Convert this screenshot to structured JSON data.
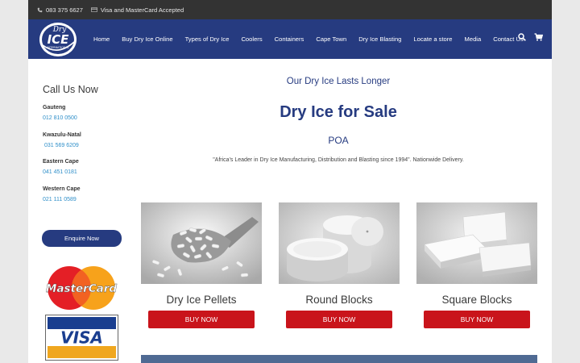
{
  "topbar": {
    "phone": "083 375 6627",
    "payments": "Visa and MasterCard Accepted",
    "phone_icon": "phone-icon",
    "card_icon": "credit-card-icon"
  },
  "logo": {
    "top": "Dry",
    "main": "ICE",
    "sub": "INTERNATIONAL"
  },
  "nav": {
    "items": [
      "Home",
      "Buy Dry Ice Online",
      "Types of Dry Ice",
      "Coolers",
      "Containers",
      "Cape Town",
      "Dry Ice Blasting",
      "Locate a store",
      "Media",
      "Contact Us"
    ],
    "search_icon": "search-icon",
    "cart_icon": "cart-icon"
  },
  "sidebar": {
    "title": "Call Us Now",
    "regions": [
      {
        "name": "Gauteng",
        "phone": "012 810 0500"
      },
      {
        "name": "Kwazulu-Natal",
        "phone": " 031 569 6209"
      },
      {
        "name": "Eastern Cape",
        "phone": "041 451 0181"
      },
      {
        "name": "Western Cape",
        "phone": "021 111 0589"
      }
    ],
    "enquire_label": "Enquire Now",
    "mastercard_text": "MasterCard",
    "visa_text": "VISA"
  },
  "main": {
    "subtitle": "Our Dry Ice Lasts Longer",
    "title": "Dry Ice for Sale",
    "price": "POA",
    "tagline": "\"Africa's Leader in Dry Ice Manufacturing, Distribution and Blasting since 1994\". Nationwide Delivery.",
    "products": [
      {
        "name": "Dry Ice Pellets",
        "button": "BUY NOW"
      },
      {
        "name": "Round Blocks",
        "button": "BUY NOW"
      },
      {
        "name": "Square Blocks",
        "button": "BUY NOW"
      }
    ]
  },
  "colors": {
    "brand_blue": "#263b80",
    "buy_red": "#c9141b",
    "link_blue": "#2f8fc9",
    "topbar": "#333333"
  }
}
